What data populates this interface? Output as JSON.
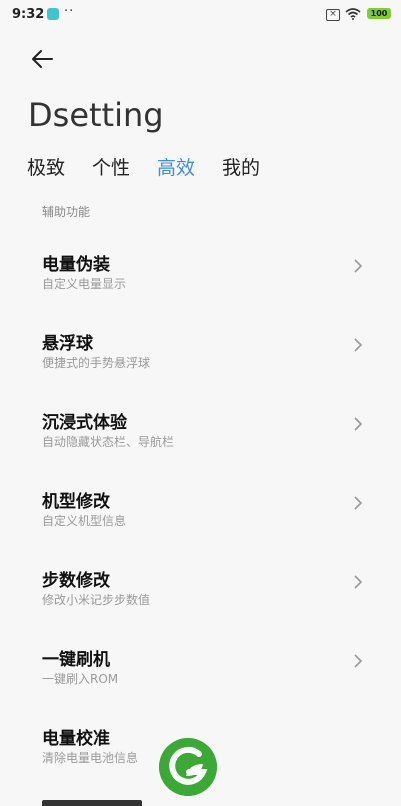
{
  "status_bar": {
    "time": "9:32",
    "notification_dots": "··",
    "battery": "100",
    "accent_app_icon_color": "#3cc6d0",
    "battery_color": "#7fcf2a"
  },
  "header": {
    "title": "Dsetting"
  },
  "tabs": [
    {
      "label": "极致",
      "active": false
    },
    {
      "label": "个性",
      "active": false
    },
    {
      "label": "高效",
      "active": true
    },
    {
      "label": "我的",
      "active": false
    }
  ],
  "accent_color": "#3b8de3",
  "section": {
    "title": "辅助功能"
  },
  "items": [
    {
      "title": "电量伪装",
      "subtitle": "自定义电量显示"
    },
    {
      "title": "悬浮球",
      "subtitle": "便捷式的手势悬浮球"
    },
    {
      "title": "沉浸式体验",
      "subtitle": "自动隐藏状态栏、导航栏"
    },
    {
      "title": "机型修改",
      "subtitle": "自定义机型信息"
    },
    {
      "title": "步数修改",
      "subtitle": "修改小米记步步数值"
    },
    {
      "title": "一键刷机",
      "subtitle": "一键刷入ROM"
    },
    {
      "title": "电量校准",
      "subtitle": "清除电量电池信息"
    }
  ],
  "icons": {
    "back": "back-arrow-icon",
    "chevron": "chevron-right-icon",
    "watermark_logo": "leaf-logo-icon"
  }
}
